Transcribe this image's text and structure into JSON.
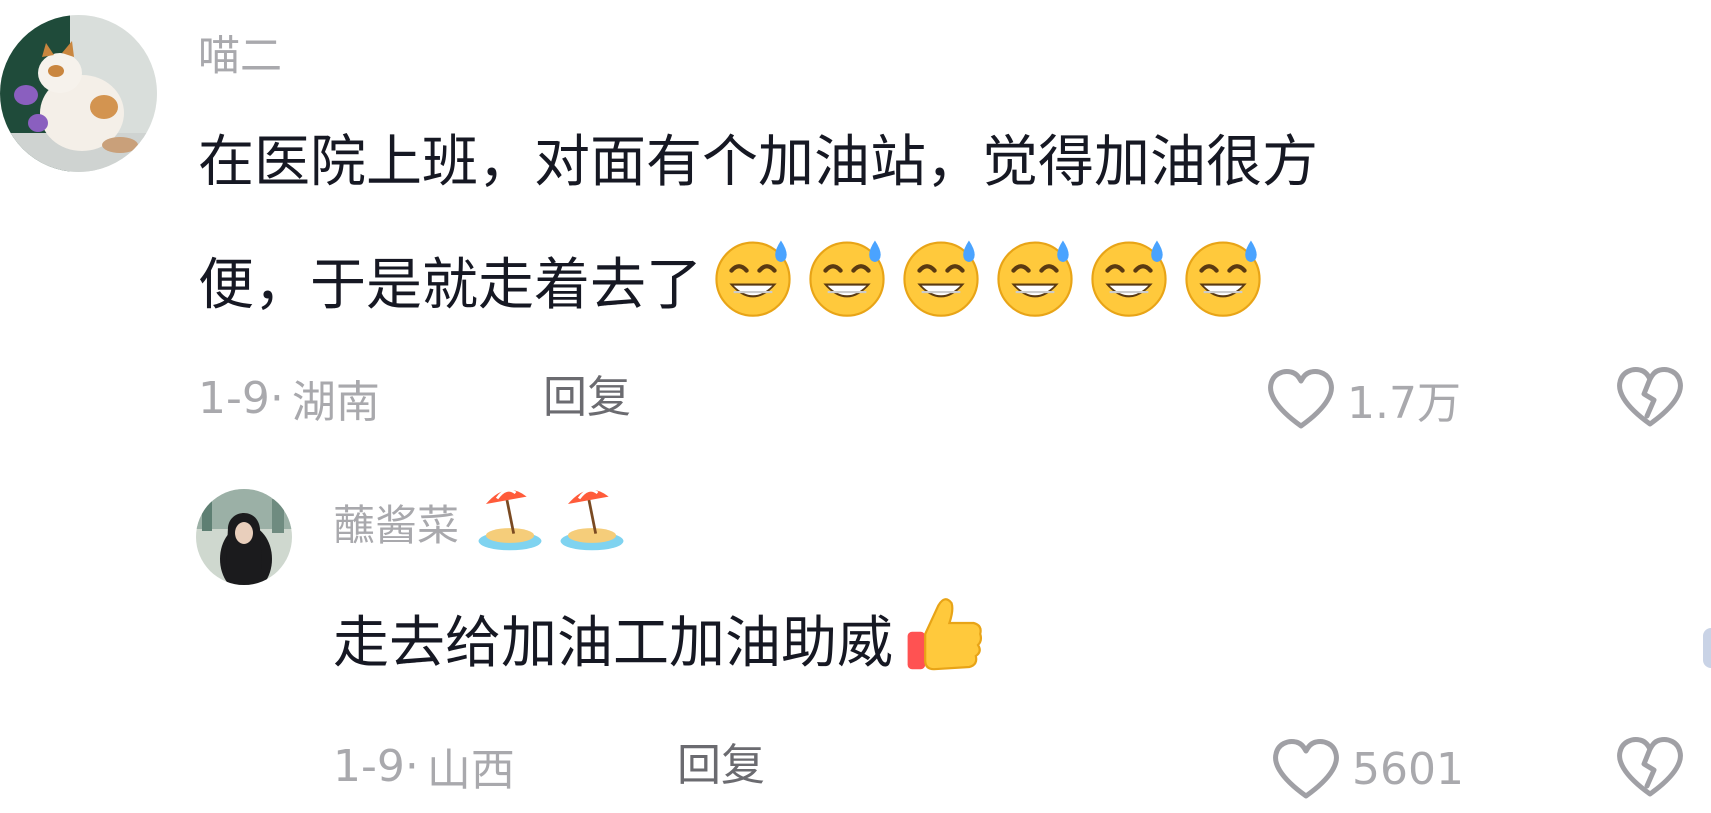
{
  "comments": [
    {
      "username": "喵二",
      "text_line1": "在医院上班，对面有个加油站，觉得加油很方",
      "text_line2": "便，于是就走着去了",
      "text_emojis": [
        "grinning-sweat",
        "grinning-sweat",
        "grinning-sweat",
        "grinning-sweat",
        "grinning-sweat",
        "grinning-sweat"
      ],
      "date": "1-9·",
      "location": "湖南",
      "reply_label": "回复",
      "like_count": "1.7万"
    },
    {
      "username": "蘸酱菜",
      "username_emojis": [
        "beach-with-umbrella",
        "beach-with-umbrella"
      ],
      "text": "走去给加油工加油助威",
      "text_emojis": [
        "thumbs-up"
      ],
      "date": "1-9·",
      "location": "山西",
      "reply_label": "回复",
      "like_count": "5601"
    }
  ],
  "colors": {
    "primary_text": "#161823",
    "secondary_text": "#a9a9ad",
    "reply_text": "#6b6b70",
    "icon_stroke": "#a0a0a5"
  }
}
